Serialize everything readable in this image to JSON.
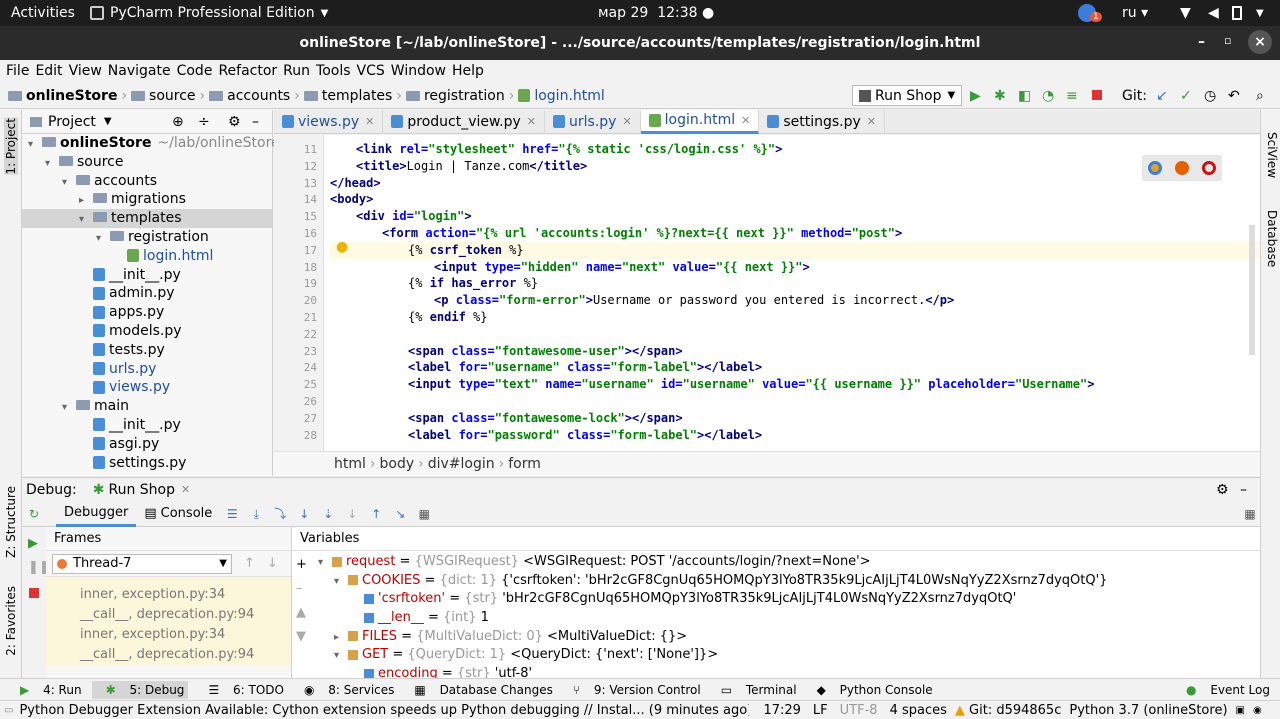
{
  "system": {
    "activities": "Activities",
    "app": "PyCharm Professional Edition",
    "date": "мар 29",
    "time": "12:38",
    "lang": "ru",
    "badge": "1"
  },
  "window": {
    "title": "onlineStore [~/lab/onlineStore] - .../source/accounts/templates/registration/login.html"
  },
  "menu": [
    "File",
    "Edit",
    "View",
    "Navigate",
    "Code",
    "Refactor",
    "Run",
    "Tools",
    "VCS",
    "Window",
    "Help"
  ],
  "breadcrumb": [
    "onlineStore",
    "source",
    "accounts",
    "templates",
    "registration",
    "login.html"
  ],
  "run_config": "Run Shop",
  "git_label": "Git:",
  "left_strip": {
    "project": "1: Project",
    "structure": "Z: Structure",
    "favorites": "2: Favorites"
  },
  "right_strip": {
    "sciview": "SciView",
    "database": "Database"
  },
  "project": {
    "title": "Project",
    "tree": [
      {
        "label": "onlineStore",
        "extra": "~/lab/onlineStore",
        "indent": 0,
        "kind": "folder",
        "bold": true
      },
      {
        "label": "source",
        "indent": 1,
        "kind": "folder"
      },
      {
        "label": "accounts",
        "indent": 2,
        "kind": "folder"
      },
      {
        "label": "migrations",
        "indent": 3,
        "kind": "folder"
      },
      {
        "label": "templates",
        "indent": 3,
        "kind": "folder",
        "selected": true
      },
      {
        "label": "registration",
        "indent": 4,
        "kind": "folder"
      },
      {
        "label": "login.html",
        "indent": 5,
        "kind": "html",
        "blue": true
      },
      {
        "label": "__init__.py",
        "indent": 3,
        "kind": "py"
      },
      {
        "label": "admin.py",
        "indent": 3,
        "kind": "py"
      },
      {
        "label": "apps.py",
        "indent": 3,
        "kind": "py"
      },
      {
        "label": "models.py",
        "indent": 3,
        "kind": "py"
      },
      {
        "label": "tests.py",
        "indent": 3,
        "kind": "py"
      },
      {
        "label": "urls.py",
        "indent": 3,
        "kind": "py",
        "blue": true
      },
      {
        "label": "views.py",
        "indent": 3,
        "kind": "py",
        "blue": true
      },
      {
        "label": "main",
        "indent": 2,
        "kind": "folder"
      },
      {
        "label": "__init__.py",
        "indent": 3,
        "kind": "py"
      },
      {
        "label": "asgi.py",
        "indent": 3,
        "kind": "py"
      },
      {
        "label": "settings.py",
        "indent": 3,
        "kind": "py"
      }
    ]
  },
  "tabs": [
    {
      "label": "views.py",
      "active": false
    },
    {
      "label": "product_view.py",
      "active": false
    },
    {
      "label": "urls.py",
      "active": false
    },
    {
      "label": "login.html",
      "active": true
    },
    {
      "label": "settings.py",
      "active": false
    }
  ],
  "editor": {
    "lines": [
      {
        "n": "11",
        "html": "<span class='t'>&lt;link </span><span class='a'>rel=</span><span class='s'>\"stylesheet\"</span> <span class='a'>href=</span><span class='s'>\"{% static 'css/login.css' %}\"</span><span class='t'>&gt;</span>",
        "indent": 1
      },
      {
        "n": "12",
        "html": "<span class='t'>&lt;title&gt;</span>Login | Tanze.com<span class='t'>&lt;/title&gt;</span>",
        "indent": 1
      },
      {
        "n": "13",
        "html": "<span class='t'>&lt;/head&gt;</span>",
        "indent": 0
      },
      {
        "n": "14",
        "html": "<span class='t'>&lt;body&gt;</span>",
        "indent": 0
      },
      {
        "n": "15",
        "html": "<span class='t'>&lt;div </span><span class='a'>id=</span><span class='s'>\"login\"</span><span class='t'>&gt;</span>",
        "indent": 1
      },
      {
        "n": "16",
        "html": "<span class='t'>&lt;form </span><span class='a'>action=</span><span class='s'>\"{% url 'accounts:login' %}?next={{ next }}\"</span> <span class='a'>method=</span><span class='s'>\"post\"</span><span class='t'>&gt;</span>",
        "indent": 2
      },
      {
        "n": "17",
        "html": "{% <span class='k'>csrf_token</span> %}",
        "indent": 3
      },
      {
        "n": "18",
        "html": "<span class='t'>&lt;input </span><span class='a'>type=</span><span class='s'>\"hidden\"</span> <span class='a'>name=</span><span class='s'>\"next\"</span> <span class='a'>value=</span><span class='s'>\"{{ next }}\"</span><span class='t'>&gt;</span>",
        "indent": 4
      },
      {
        "n": "19",
        "html": "{% <span class='k'>if has_error</span> %}",
        "indent": 3
      },
      {
        "n": "20",
        "html": "<span class='t'>&lt;p </span><span class='a'>class=</span><span class='s'>\"form-error\"</span><span class='t'>&gt;</span>Username or password you entered is incorrect.<span class='t'>&lt;/p&gt;</span>",
        "indent": 4
      },
      {
        "n": "21",
        "html": "{% <span class='k'>endif</span> %}",
        "indent": 3
      },
      {
        "n": "22",
        "html": "",
        "indent": 0
      },
      {
        "n": "23",
        "html": "<span class='t'>&lt;span </span><span class='a'>class=</span><span class='s'>\"fontawesome-user\"</span><span class='t'>&gt;&lt;/span&gt;</span>",
        "indent": 3
      },
      {
        "n": "24",
        "html": "<span class='t'>&lt;label </span><span class='a'>for=</span><span class='s'>\"username\"</span> <span class='a'>class=</span><span class='s'>\"form-label\"</span><span class='t'>&gt;&lt;/label&gt;</span>",
        "indent": 3
      },
      {
        "n": "25",
        "html": "<span class='t'>&lt;input </span><span class='a'>type=</span><span class='s'>\"text\"</span> <span class='a'>name=</span><span class='s'>\"username\"</span> <span class='a'>id=</span><span class='s'>\"username\"</span> <span class='a'>value=</span><span class='s'>\"{{ username }}\"</span> <span class='a'>placeholder=</span><span class='s'>\"Username\"</span><span class='t'>&gt;</span>",
        "indent": 3
      },
      {
        "n": "26",
        "html": "",
        "indent": 0
      },
      {
        "n": "27",
        "html": "<span class='t'>&lt;span </span><span class='a'>class=</span><span class='s'>\"fontawesome-lock\"</span><span class='t'>&gt;&lt;/span&gt;</span>",
        "indent": 3
      },
      {
        "n": "28",
        "html": "<span class='t'>&lt;label </span><span class='a'>for=</span><span class='s'>\"password\"</span> <span class='a'>class=</span><span class='s'>\"form-label\"</span><span class='t'>&gt;&lt;/label&gt;</span>",
        "indent": 3
      }
    ]
  },
  "crumbs": [
    "html",
    "body",
    "div#login",
    "form"
  ],
  "debug": {
    "label": "Debug:",
    "config": "Run Shop",
    "tabs": [
      "Debugger",
      "Console"
    ],
    "frames_title": "Frames",
    "thread": "Thread-7",
    "variables_title": "Variables",
    "frames": [
      "inner, exception.py:34",
      "__call__, deprecation.py:94",
      "inner, exception.py:34",
      "__call__, deprecation.py:94"
    ],
    "vars": [
      {
        "indent": 0,
        "arrow": "▾",
        "badge": "obj",
        "name": "request",
        "type": "{WSGIRequest}",
        "value": "<WSGIRequest: POST '/accounts/login/?next=None'>"
      },
      {
        "indent": 1,
        "arrow": "▾",
        "badge": "obj",
        "name": "COOKIES",
        "type": "{dict: 1}",
        "value": "{'csrftoken': 'bHr2cGF8CgnUq65HOMQpY3lYo8TR35k9LjcAIjLjT4L0WsNqYyZ2Xsrnz7dyqOtQ'}"
      },
      {
        "indent": 2,
        "arrow": "",
        "badge": "str",
        "name": "'csrftoken'",
        "type": "{str}",
        "value": "'bHr2cGF8CgnUq65HOMQpY3lYo8TR35k9LjcAIjLjT4L0WsNqYyZ2Xsrnz7dyqOtQ'"
      },
      {
        "indent": 2,
        "arrow": "",
        "badge": "str",
        "name": "__len__",
        "type": "{int}",
        "value": "1"
      },
      {
        "indent": 1,
        "arrow": "▸",
        "badge": "obj",
        "name": "FILES",
        "type": "{MultiValueDict: 0}",
        "value": "<MultiValueDict: {}>"
      },
      {
        "indent": 1,
        "arrow": "▾",
        "badge": "obj",
        "name": "GET",
        "type": "{QueryDict: 1}",
        "value": "<QueryDict: {'next': ['None']}>"
      },
      {
        "indent": 2,
        "arrow": "",
        "badge": "str",
        "name": "encoding",
        "type": "{str}",
        "value": "'utf-8'"
      }
    ]
  },
  "bottom_tools": [
    "4: Run",
    "5: Debug",
    "6: TODO",
    "8: Services",
    "Database Changes",
    "9: Version Control",
    "Terminal",
    "Python Console"
  ],
  "event_log": "Event Log",
  "status": {
    "message": "Python Debugger Extension Available: Cython extension speeds up Python debugging // Instal... (9 minutes ago)",
    "pos": "17:29",
    "eol": "LF",
    "enc": "UTF-8",
    "indent": "4 spaces",
    "git": "Git: d594865c",
    "interp": "Python 3.7 (onlineStore)"
  }
}
